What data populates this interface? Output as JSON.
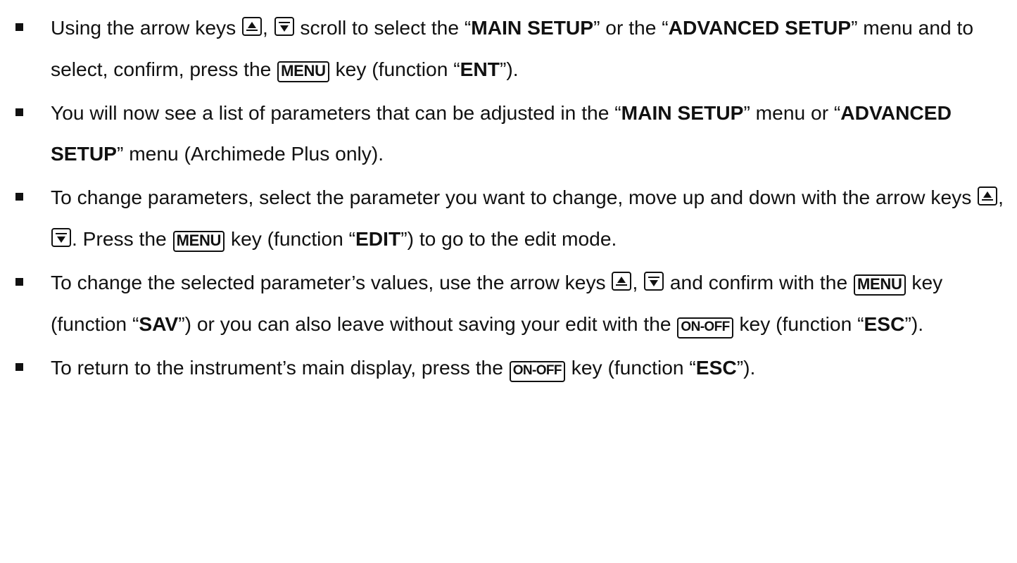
{
  "keys": {
    "arrow_up": "arrow-up-key",
    "arrow_down": "arrow-down-key",
    "menu": "MENU",
    "onoff": "ON-OFF"
  },
  "bullet1": {
    "t1": "Using the arrow keys",
    "t2": ", ",
    "t3": " scroll to select the “",
    "b1": "MAIN SETUP",
    "t4": "” or the “",
    "b2": "ADVANCED SETUP",
    "t5": "” menu and to select, confirm, press the ",
    "t6": " key (function “",
    "b3": "ENT",
    "t7": "”)."
  },
  "bullet2": {
    "t1": "You will now see a list of parameters that can be adjusted in the “",
    "b1": "MAIN SETUP",
    "t2": "” menu or “",
    "b2": "ADVANCED SETUP",
    "t3": "” menu (Archimede Plus only)."
  },
  "bullet3": {
    "t1": "To change parameters, select the parameter you want to change, move up and down with the arrow keys ",
    "t2": ", ",
    "t3": ". Press the ",
    "t4": " key (function “",
    "b1": "EDIT",
    "t5": "”) to go to the edit mode."
  },
  "bullet4": {
    "t1": "To change the selected parameter’s values, use the arrow keys ",
    "t2": ", ",
    "t3": " and confirm with the ",
    "t4": " key (function “",
    "b1": "SAV",
    "t5": "”) or you can also leave without saving your edit with the ",
    "t6": " key (function “",
    "b2": "ESC",
    "t7": "”)."
  },
  "bullet5": {
    "t1": "To return to the instrument’s main display, press the ",
    "t2": " key (function “",
    "b1": "ESC",
    "t3": "”)."
  }
}
